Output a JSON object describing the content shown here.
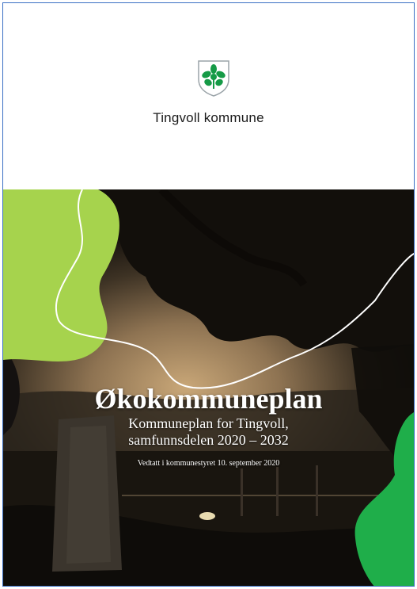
{
  "header": {
    "organization": "Tingvoll kommune",
    "crest_icon": "oak-leaf-crest-icon"
  },
  "cover": {
    "title": "Økokommuneplan",
    "subtitle_line1": "Kommuneplan for Tingvoll,",
    "subtitle_line2": "samfunnsdelen 2020 – 2032",
    "approval": "Vedtatt i kommunestyret 10. september 2020"
  },
  "colors": {
    "accent_light_green": "#a6d34d",
    "accent_dark_green": "#1fae4a",
    "crest_green": "#159a46",
    "border_blue": "#3a6fc4"
  }
}
